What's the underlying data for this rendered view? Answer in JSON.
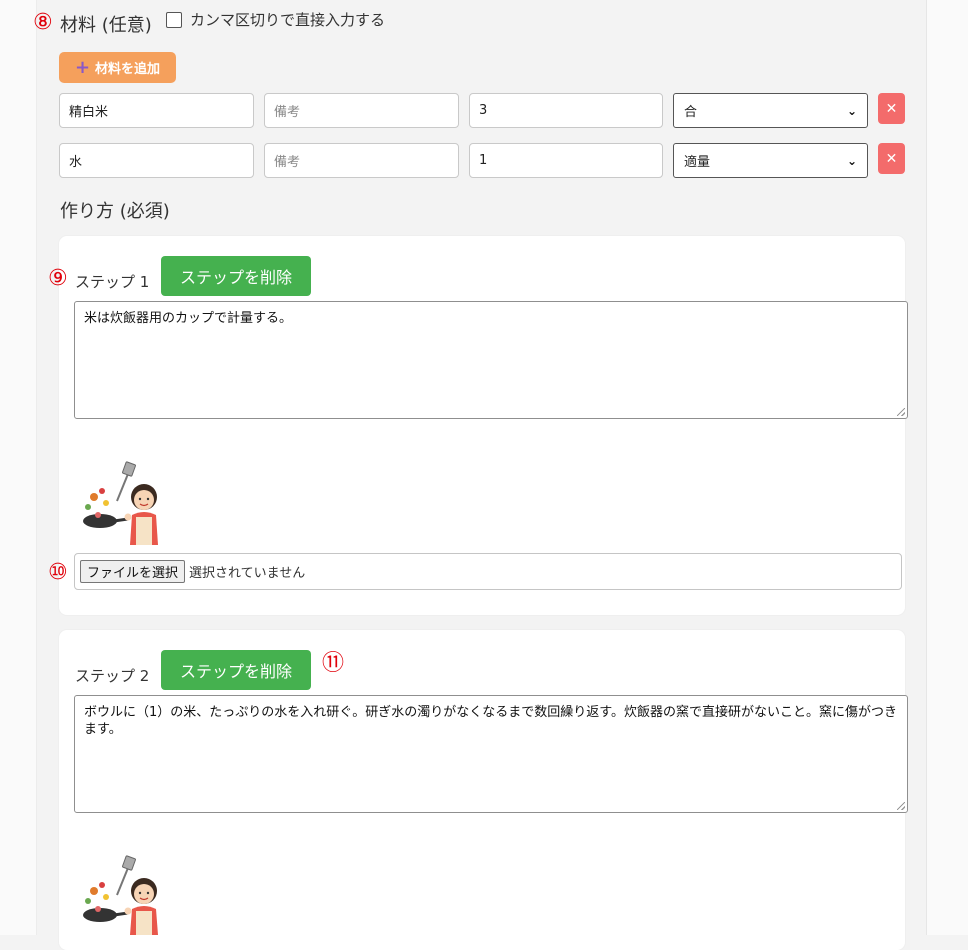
{
  "markers": {
    "m8": "⑧",
    "m9": "⑨",
    "m10": "⑩",
    "m11": "⑪"
  },
  "ingredients": {
    "title": "材料 (任意)",
    "comma_checkbox_label": "カンマ区切りで直接入力する",
    "add_button_label": "材料を追加",
    "add_icon": "plus-icon",
    "rows": [
      {
        "name": "精白米",
        "note_placeholder": "備考",
        "amount": "3",
        "unit": "合"
      },
      {
        "name": "水",
        "note_placeholder": "備考",
        "amount": "1",
        "unit": "適量"
      }
    ],
    "delete_icon": "close-icon",
    "delete_glyph": "✕"
  },
  "method": {
    "title": "作り方 (必須)",
    "steps": [
      {
        "label": "ステップ 1",
        "delete_label": "ステップを削除",
        "text": "米は炊飯器用のカップで計量する。",
        "file_button": "ファイルを選択",
        "file_status": "選択されていません"
      },
      {
        "label": "ステップ 2",
        "delete_label": "ステップを削除",
        "text": "ボウルに（1）の米、たっぷりの水を入れ研ぐ。研ぎ水の濁りがなくなるまで数回繰り返す。炊飯器の窯で直接研がないこと。窯に傷がつきます。"
      }
    ]
  },
  "colors": {
    "add_button": "#f5a05c",
    "step_delete": "#45b14f",
    "row_delete": "#f36b6b",
    "marker": "#e0000a"
  }
}
